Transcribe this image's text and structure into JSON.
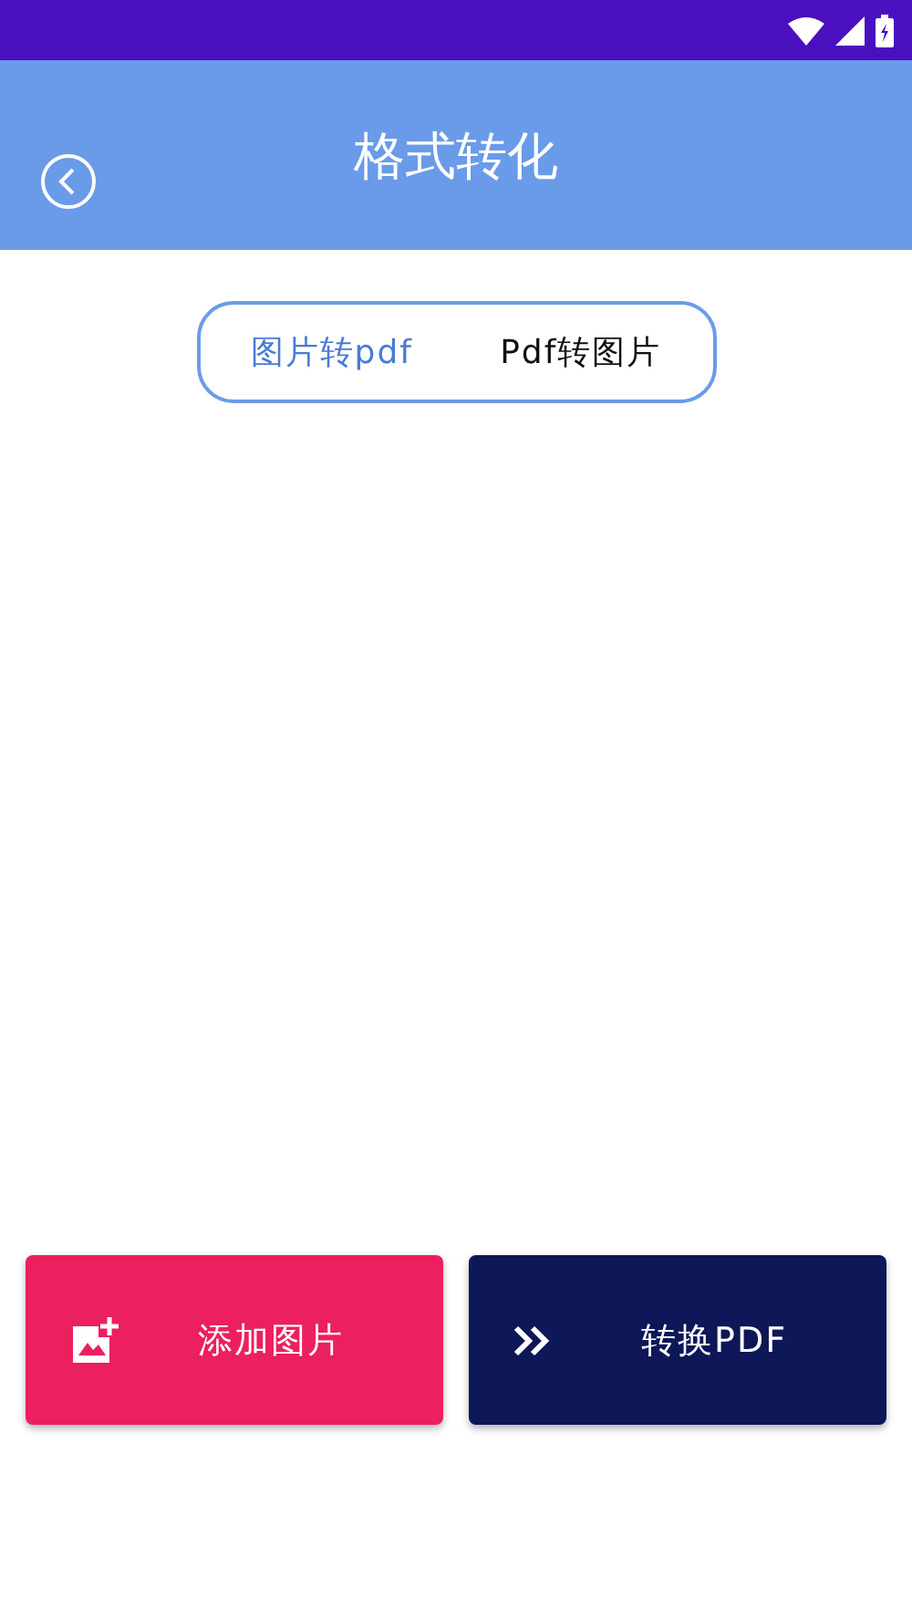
{
  "app_bar": {
    "title": "格式转化"
  },
  "tabs": [
    {
      "label": "图片转pdf",
      "selected": true
    },
    {
      "label": "Pdf转图片",
      "selected": false
    }
  ],
  "buttons": [
    {
      "kind": "add-image",
      "label": "添加图片"
    },
    {
      "kind": "convert",
      "label": "转换PDF"
    }
  ]
}
